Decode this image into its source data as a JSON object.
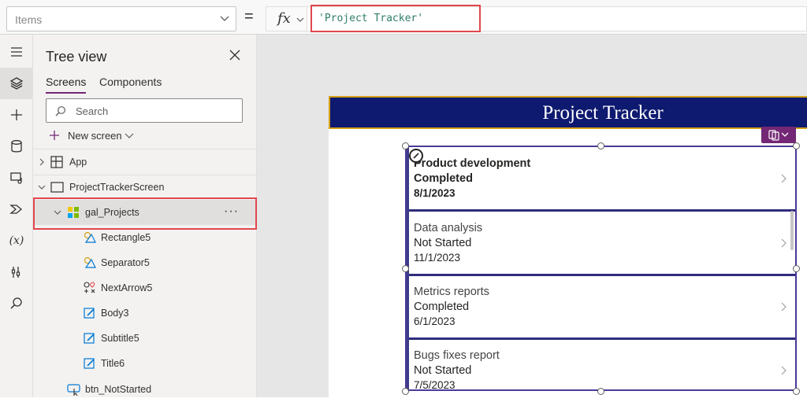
{
  "formula_bar": {
    "property": "Items",
    "equals": "=",
    "fx_label": "fx",
    "formula": "'Project Tracker'"
  },
  "rail": {
    "items": [
      "hamburger-icon",
      "layers-icon",
      "plus-icon",
      "database-icon",
      "media-icon",
      "power-automate-icon",
      "variables-icon",
      "tools-icon",
      "search-icon"
    ],
    "variables_label": "(x)"
  },
  "tree": {
    "title": "Tree view",
    "tabs": [
      "Screens",
      "Components"
    ],
    "search_placeholder": "Search",
    "new_screen": "New screen",
    "app_label": "App",
    "screen_label": "ProjectTrackerScreen",
    "gallery_label": "gal_Projects",
    "more": "···",
    "children": [
      "Rectangle5",
      "Separator5",
      "NextArrow5",
      "Body3",
      "Subtitle5",
      "Title6"
    ],
    "button_label": "btn_NotStarted"
  },
  "canvas": {
    "header_title": "Project Tracker",
    "accent_color": "#0e1970",
    "border_color": "#d4a017",
    "gallery_items": [
      {
        "title": "Product development",
        "status": "Completed",
        "date": "8/1/2023"
      },
      {
        "title": "Data analysis",
        "status": "Not Started",
        "date": "11/1/2023"
      },
      {
        "title": "Metrics reports",
        "status": "Completed",
        "date": "6/1/2023"
      },
      {
        "title": "Bugs fixes report",
        "status": "Not Started",
        "date": "7/5/2023"
      }
    ]
  }
}
